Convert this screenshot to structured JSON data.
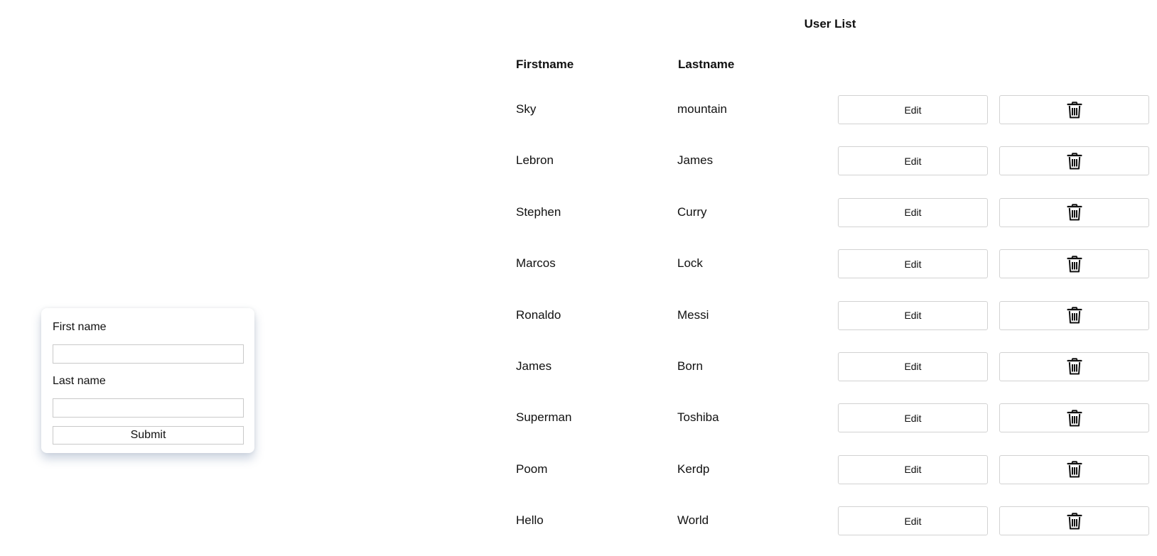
{
  "form": {
    "first_name_label": "First name",
    "first_name_value": "",
    "last_name_label": "Last name",
    "last_name_value": "",
    "submit_label": "Submit"
  },
  "user_list": {
    "title": "User List",
    "columns": {
      "firstname": "Firstname",
      "lastname": "Lastname"
    },
    "edit_label": "Edit",
    "delete_icon": "trash-icon",
    "rows": [
      {
        "firstname": "Sky",
        "lastname": "mountain"
      },
      {
        "firstname": "Lebron",
        "lastname": "James"
      },
      {
        "firstname": "Stephen",
        "lastname": "Curry"
      },
      {
        "firstname": "Marcos",
        "lastname": "Lock"
      },
      {
        "firstname": "Ronaldo",
        "lastname": "Messi"
      },
      {
        "firstname": "James",
        "lastname": "Born"
      },
      {
        "firstname": "Superman",
        "lastname": "Toshiba"
      },
      {
        "firstname": "Poom",
        "lastname": "Kerdp"
      },
      {
        "firstname": "Hello",
        "lastname": "World"
      }
    ]
  }
}
